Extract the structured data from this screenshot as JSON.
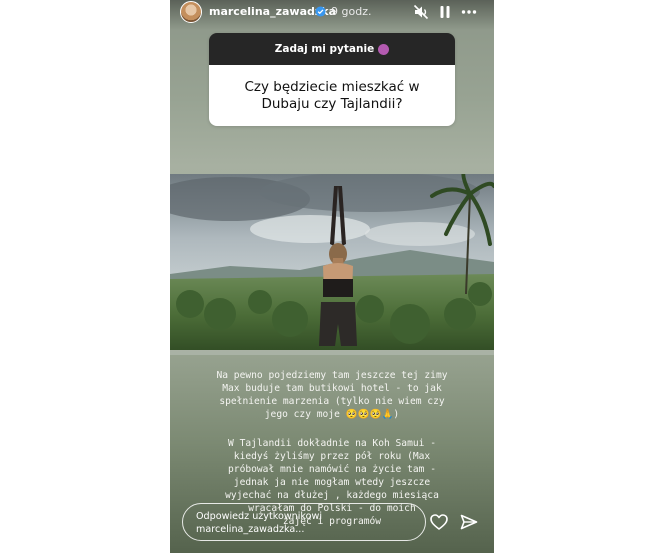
{
  "story": {
    "username": "marcelina_zawadzka",
    "time": "9 godz.",
    "icons": [
      "mute-icon",
      "pause-icon",
      "more-icon",
      "heart-icon",
      "send-icon",
      "verified-icon"
    ]
  },
  "question": {
    "header": "Zadaj mi pytanie",
    "text": "Czy będziecie mieszkać w Dubaju czy Tajlandii?"
  },
  "caption": {
    "paragraph1": "Na pewno pojedziemy tam jeszcze tej zimy\nMax buduje tam butikowi hotel - to jak\nspełnienie marzenia (tylko nie wiem czy\njego czy moje 🥺🥺🥺🙏)",
    "paragraph2": "W Tajlandii dokładnie na Koh Samui -\nkiedyś żyliśmy przez pół roku (Max\npróbował mnie namówić na życie tam -\njednak ja nie mogłam wtedy jeszcze\nwyjechać na dłużej , każdego miesiąca\nwracałam do Polski - do moich\nzajęć i programów"
  },
  "reply": {
    "placeholder": "Odpowiedz użytkownikowi\nmarcelina_zawadzka..."
  },
  "colors": {
    "question_header_bg": "#262626",
    "verified": "#3897f0"
  }
}
